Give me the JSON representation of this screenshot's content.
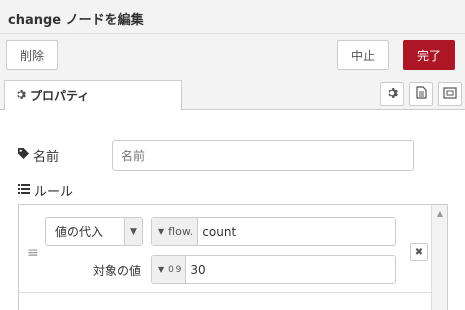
{
  "dialog": {
    "title": "change ノードを編集"
  },
  "toolbar": {
    "delete_label": "削除",
    "cancel_label": "中止",
    "done_label": "完了"
  },
  "tabs": {
    "properties_label": "プロパティ"
  },
  "form": {
    "name_label": "名前",
    "name_placeholder": "名前",
    "name_value": "",
    "rules_label": "ルール"
  },
  "rule": {
    "action": "値の代入",
    "target_type": "flow.",
    "target_value": "count",
    "value_label": "対象の値",
    "value_type": "0 9",
    "value_value": "30"
  },
  "colors": {
    "accent": "#ad1625",
    "header_bg": "#f3f3f3"
  },
  "icons": [
    "gear-icon",
    "description-icon",
    "appearance-icon",
    "tag-icon",
    "list-icon",
    "drag-handle-icon",
    "remove-icon"
  ]
}
